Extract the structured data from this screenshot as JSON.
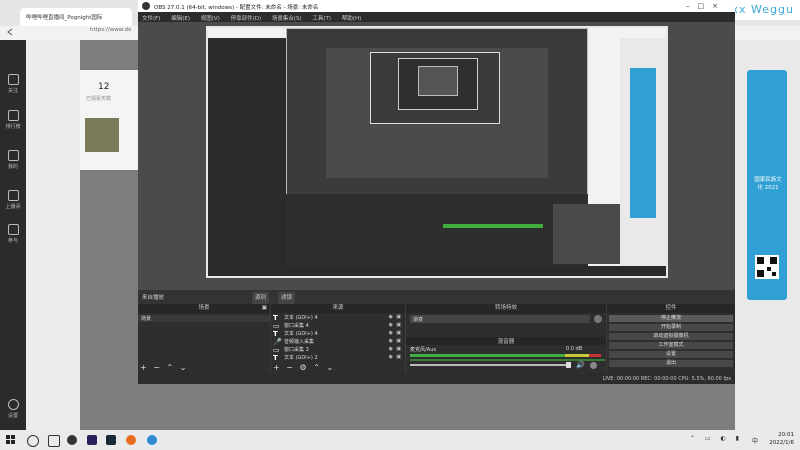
{
  "browser": {
    "tab_title": "哔哩哔哩直播间_Pognight国际",
    "address": "https://www.do",
    "sidebar_items": [
      "关注",
      "排行榜",
      "我的",
      "上播间",
      "参与",
      "设置"
    ],
    "profile_count": "12",
    "profile_sub": "已观看天数",
    "right_top_text": "Vlogxx Weggu",
    "qr_caption": "国家民族文化 2021"
  },
  "obs": {
    "title": "OBS 27.0.1 (64-bit, windows) - 配置文件: 未命名 - 场景: 未命名",
    "menu": [
      "文件(F)",
      "编辑(E)",
      "视图(V)",
      "停靠部件(D)",
      "场景集合(S)",
      "工具(T)",
      "帮助(H)"
    ],
    "scene_tab1": "来自播放",
    "scene_tab2": "源别",
    "scene_tab3": "滤镜",
    "scenes_title": "场景",
    "scenes": [
      "场景"
    ],
    "sources_title": "来源",
    "sources": [
      {
        "icon": "T",
        "label": "文本 (GDI+) 4"
      },
      {
        "icon": "▭",
        "label": "窗口采集 4"
      },
      {
        "icon": "T",
        "label": "文本 (GDI+) 4"
      },
      {
        "icon": "🎤",
        "label": "音频输入采集"
      },
      {
        "icon": "▭",
        "label": "窗口采集 3"
      },
      {
        "icon": "T",
        "label": "文本 (GDI+) 2"
      }
    ],
    "transitions_title": "转场特效",
    "transition_select": "渐变",
    "mixer_title": "混音器",
    "mixer_track": "麦克风/Aux",
    "mixer_db": "0.0 dB",
    "controls_title": "控件",
    "controls": [
      "停止推流",
      "开始录制",
      "启动虚拟摄像机",
      "工作室模式",
      "设置",
      "退出"
    ],
    "status": "LIVE: 00:00:00    REC: 00:00:00    CPU: 5.5%, 60.00 fps"
  },
  "taskbar": {
    "time": "20:01",
    "date": "2022/1/6",
    "lang": "中"
  },
  "colors": {
    "accent": "#3da9d8",
    "obs_bg": "#3b3b3b",
    "meter_green": "#3fae3f",
    "meter_red": "#c83232"
  }
}
